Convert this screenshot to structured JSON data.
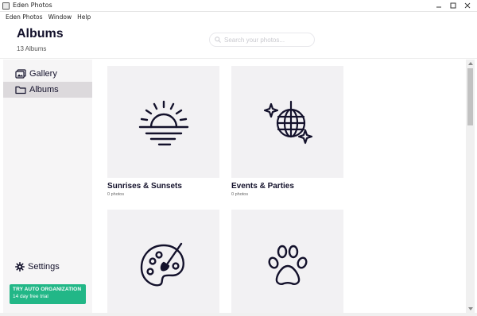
{
  "window": {
    "title": "Eden Photos"
  },
  "menu": [
    "Eden Photos",
    "Window",
    "Help"
  ],
  "header": {
    "title": "Albums",
    "subtitle": "13 Albums"
  },
  "search": {
    "placeholder": "Search your photos..."
  },
  "sidebar": {
    "items": [
      {
        "label": "Gallery",
        "icon": "gallery-icon"
      },
      {
        "label": "Albums",
        "icon": "folder-icon",
        "selected": true
      }
    ],
    "settings_label": "Settings",
    "promo": {
      "title": "TRY AUTO ORGANIZATION",
      "subtitle": "14 day free trial",
      "color": "#22b787"
    }
  },
  "albums": [
    {
      "name": "Sunrises & Sunsets",
      "count": "0 photos",
      "icon": "sunset-icon"
    },
    {
      "name": "Events & Parties",
      "count": "0 photos",
      "icon": "disco-ball-icon"
    },
    {
      "name": "",
      "count": "",
      "icon": "palette-icon"
    },
    {
      "name": "",
      "count": "",
      "icon": "paw-icon"
    }
  ],
  "colors": {
    "accent": "#22b787",
    "card_bg": "#f2f1f3",
    "sidebar_bg": "#f6f5f6",
    "selected_bg": "#dcd9dc"
  }
}
